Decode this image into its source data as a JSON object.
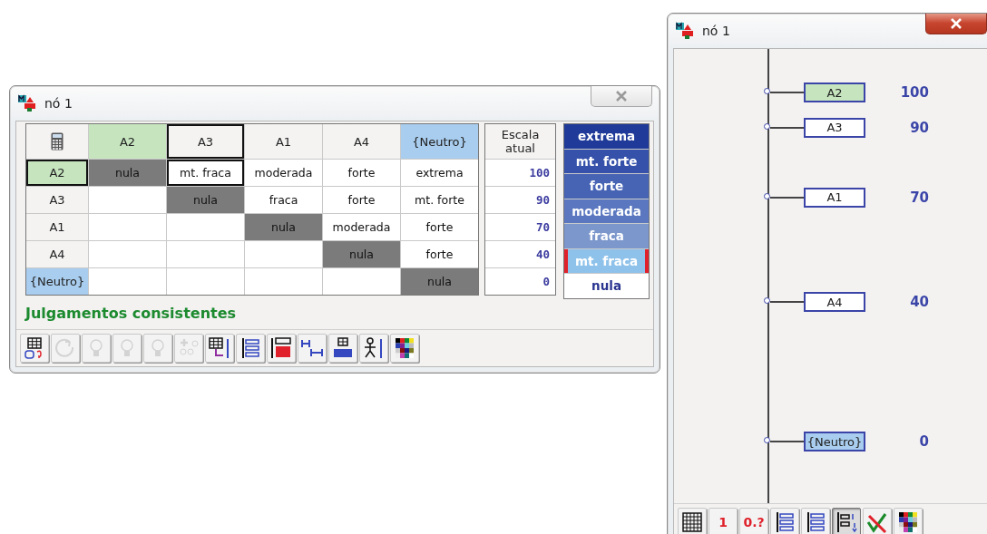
{
  "matrix_window": {
    "title": "nó 1",
    "columns": [
      {
        "label": "A2",
        "color": "#c6e5bf",
        "selected": false
      },
      {
        "label": "A3",
        "color": "#f4f3f2",
        "selected": true
      },
      {
        "label": "A1",
        "color": "#f4f3f2",
        "selected": false
      },
      {
        "label": "A4",
        "color": "#f4f3f2",
        "selected": false
      },
      {
        "label": "{Neutro}",
        "color": "#a9cdee",
        "selected": false
      }
    ],
    "rows": [
      {
        "label": "A2",
        "color": "#c6e5bf",
        "selected": true,
        "cells": [
          {
            "text": "nula",
            "selected": false
          },
          {
            "text": "mt. fraca",
            "selected": true
          },
          {
            "text": "moderada",
            "selected": false
          },
          {
            "text": "forte",
            "selected": false
          },
          {
            "text": "extrema",
            "selected": false
          }
        ],
        "scale": "100"
      },
      {
        "label": "A3",
        "color": "#f4f3f2",
        "selected": false,
        "cells": [
          {
            "selected": false
          },
          {
            "text": "nula",
            "selected": false
          },
          {
            "text": "fraca",
            "selected": false
          },
          {
            "text": "forte",
            "selected": false
          },
          {
            "text": "mt. forte",
            "selected": false
          }
        ],
        "scale": "90"
      },
      {
        "label": "A1",
        "color": "#f4f3f2",
        "selected": false,
        "cells": [
          {
            "selected": false
          },
          {
            "selected": false
          },
          {
            "text": "nula",
            "selected": false
          },
          {
            "text": "moderada",
            "selected": false
          },
          {
            "text": "forte",
            "selected": false
          }
        ],
        "scale": "70"
      },
      {
        "label": "A4",
        "color": "#f4f3f2",
        "selected": false,
        "cells": [
          {
            "selected": false
          },
          {
            "selected": false
          },
          {
            "selected": false
          },
          {
            "text": "nula",
            "selected": false
          },
          {
            "text": "forte",
            "selected": false
          }
        ],
        "scale": "40"
      },
      {
        "label": "{Neutro}",
        "color": "#a9cdee",
        "selected": false,
        "cells": [
          {
            "selected": false
          },
          {
            "selected": false
          },
          {
            "selected": false
          },
          {
            "selected": false
          },
          {
            "text": "nula",
            "selected": false
          }
        ],
        "scale": "0"
      }
    ],
    "scale_header": "Escala atual",
    "categories": [
      {
        "label": "extrema",
        "color": "#1f3a98",
        "selected": false
      },
      {
        "label": "mt. forte",
        "color": "#3551a9",
        "selected": false
      },
      {
        "label": "forte",
        "color": "#4764b4",
        "selected": false
      },
      {
        "label": "moderada",
        "color": "#5a77bf",
        "selected": false
      },
      {
        "label": "fraca",
        "color": "#7b97cc",
        "selected": false
      },
      {
        "label": "mt. fraca",
        "color": "#8ec2ea",
        "selected": true
      },
      {
        "label": "nula",
        "color": "#ffffff",
        "selected": false
      }
    ],
    "status": "Julgamentos consistentes",
    "toolbar": [
      {
        "kind": "grid-ok",
        "disabled": false
      },
      {
        "kind": "refresh",
        "disabled": true
      },
      {
        "kind": "bulb",
        "disabled": true
      },
      {
        "kind": "bulb",
        "disabled": true
      },
      {
        "kind": "bulb",
        "disabled": true
      },
      {
        "kind": "people",
        "disabled": true
      },
      {
        "kind": "grid-arrow",
        "disabled": false
      },
      {
        "kind": "bars",
        "disabled": false
      },
      {
        "kind": "macbeth",
        "disabled": false
      },
      {
        "kind": "interval",
        "disabled": false
      },
      {
        "kind": "diff",
        "disabled": false
      },
      {
        "kind": "figure",
        "disabled": false
      },
      {
        "kind": "palette",
        "disabled": false
      }
    ]
  },
  "scale_window": {
    "title": "nó 1",
    "nodes": [
      {
        "label": "A2",
        "value": "100",
        "level": 1,
        "color": "#c6e5bf"
      },
      {
        "label": "A3",
        "value": "90",
        "level": 0.9,
        "color": "#ffffff"
      },
      {
        "label": "A1",
        "value": "70",
        "level": 0.7,
        "color": "#ffffff"
      },
      {
        "label": "A4",
        "value": "40",
        "level": 0.4,
        "color": "#ffffff"
      },
      {
        "label": "{Neutro}",
        "value": "0",
        "level": 0,
        "color": "#a9cdee"
      }
    ],
    "toolbar": [
      {
        "kind": "grid",
        "selected": false
      },
      {
        "kind": "text",
        "label": "1",
        "selected": false
      },
      {
        "kind": "text",
        "label": "0.?",
        "selected": false
      },
      {
        "kind": "bars",
        "selected": false
      },
      {
        "kind": "bars",
        "selected": false
      },
      {
        "kind": "numbered",
        "selected": true
      },
      {
        "kind": "check",
        "selected": false
      },
      {
        "kind": "palette",
        "selected": false
      }
    ]
  }
}
